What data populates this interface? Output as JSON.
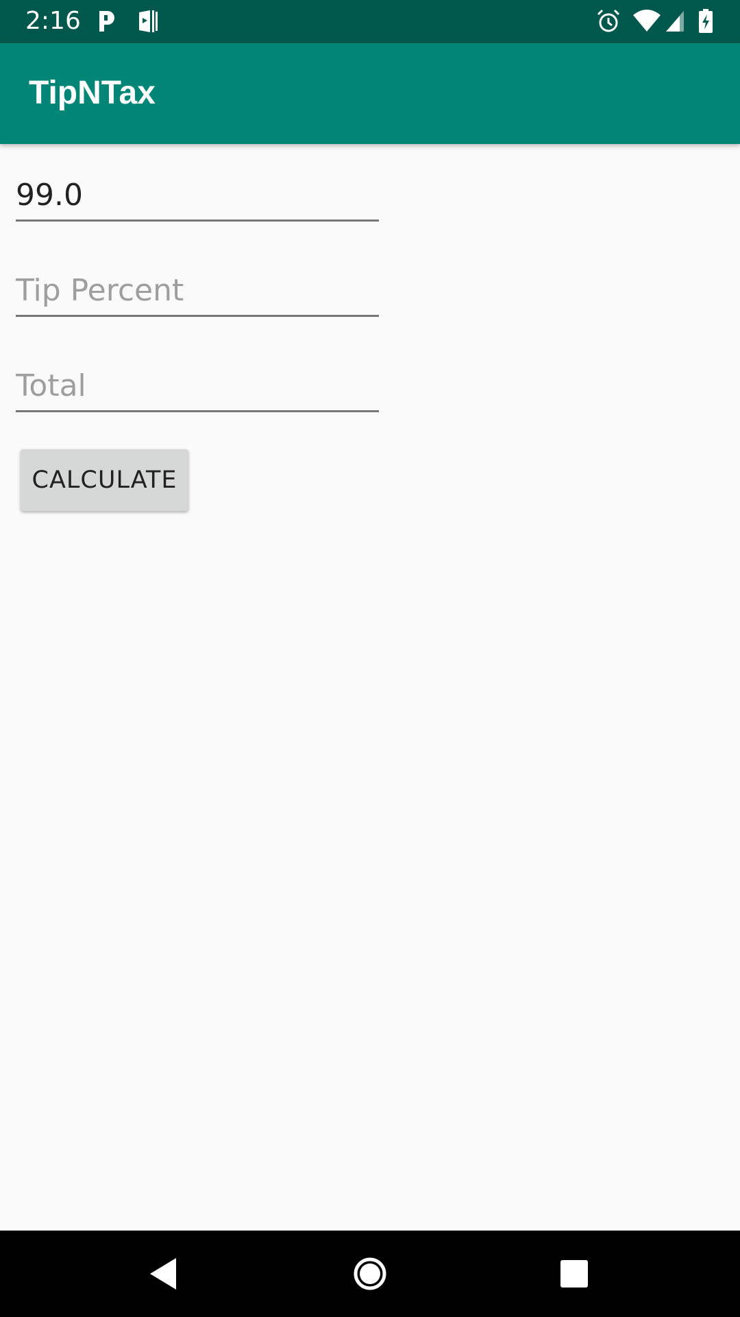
{
  "status_bar": {
    "time": "2:16",
    "left_icons": [
      "parking-p-icon",
      "play-books-icon"
    ],
    "right_icons": [
      "alarm-icon",
      "wifi-icon",
      "cell-signal-icon",
      "battery-charging-icon"
    ],
    "color": "#00574b"
  },
  "app_bar": {
    "title": "TipNTax",
    "color": "#008577"
  },
  "form": {
    "amount": {
      "value": "99.0",
      "placeholder": ""
    },
    "tip_percent": {
      "value": "",
      "placeholder": "Tip Percent"
    },
    "total": {
      "value": "",
      "placeholder": "Total"
    },
    "calculate_label": "CALCULATE"
  },
  "nav_bar": {
    "icons": [
      "back-icon",
      "home-icon",
      "recents-icon"
    ]
  }
}
